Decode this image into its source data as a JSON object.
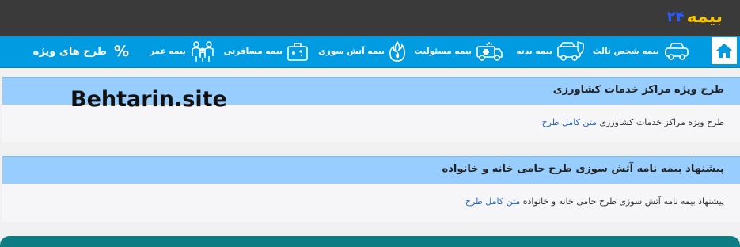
{
  "logo": {
    "word": "بیمه",
    "number": "۲۴"
  },
  "nav": {
    "items": [
      {
        "label": "بیمه شخص ثالث",
        "icon": "third-party-car-icon"
      },
      {
        "label": "بیمه بدنه",
        "icon": "car-body-icon"
      },
      {
        "label": "بیمه مسئولیت",
        "icon": "ambulance-icon"
      },
      {
        "label": "بیمه آتش سوزی",
        "icon": "fire-icon"
      },
      {
        "label": "بیمه مسافرتی",
        "icon": "suitcase-icon"
      },
      {
        "label": "بیمه عمر",
        "icon": "family-icon"
      }
    ],
    "special": {
      "label": "طرح های ویژه",
      "symbol": "%"
    }
  },
  "cards": [
    {
      "title": "طرح ویژه مراکز خدمات کشاورزی",
      "text": "طرح ویژه مراکز خدمات کشاورزی",
      "link": "متن کامل طرح"
    },
    {
      "title": "پیشنهاد بیمه نامه آتش سوزی طرح حامی خانه و خانواده",
      "text": "پیشنهاد بیمه نامه آتش سوزی طرح حامی خانه و خانواده",
      "link": "متن کامل طرح"
    }
  ],
  "watermark": "Behtarin.site",
  "colors": {
    "topbar": "#3a3a3a",
    "nav": "#009be0",
    "card_head": "#98cdff",
    "link": "#2266cc",
    "footer": "#0e7d83"
  }
}
